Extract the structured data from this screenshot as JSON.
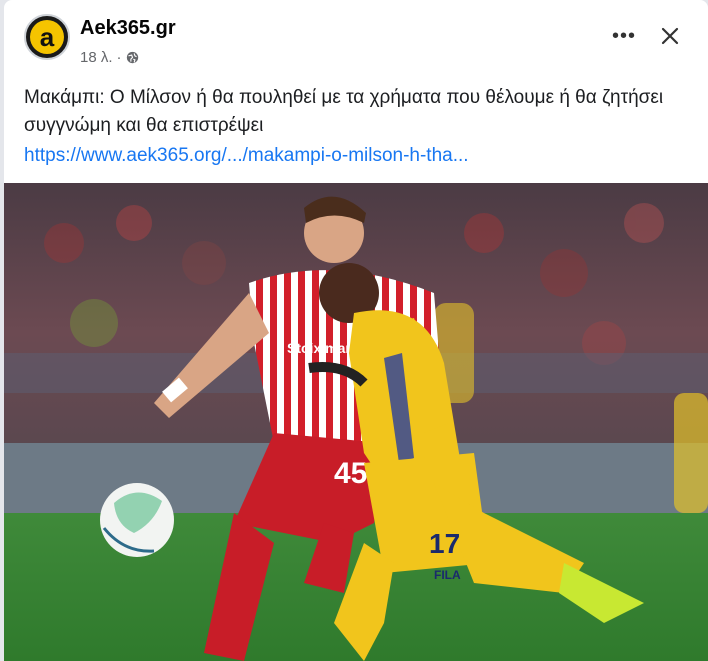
{
  "post": {
    "page_name": "Aek365.gr",
    "timestamp": "18 λ.",
    "separator": "·",
    "audience_icon": "globe-icon",
    "avatar_letter": "a",
    "text": "Μακάμπι: Ο Μίλσον ή θα πουληθεί με τα χρήματα που θέλουμε ή θα ζητήσει συγγνώμη και θα επιστρέψει",
    "link": "https://www.aek365.org/.../makampi-o-milson-h-tha..."
  },
  "actions": {
    "more_icon": "more-options-icon",
    "more_label": "•••",
    "close_icon": "close-icon"
  },
  "photo": {
    "player_red_number": "45",
    "player_yellow_number": "17",
    "sponsor_red": "Stoiximan",
    "sponsor_yellow": "FILA"
  },
  "colors": {
    "link": "#1877f2",
    "text": "#1c1e21",
    "meta": "#65676b",
    "avatar_bg": "#f5c400"
  }
}
